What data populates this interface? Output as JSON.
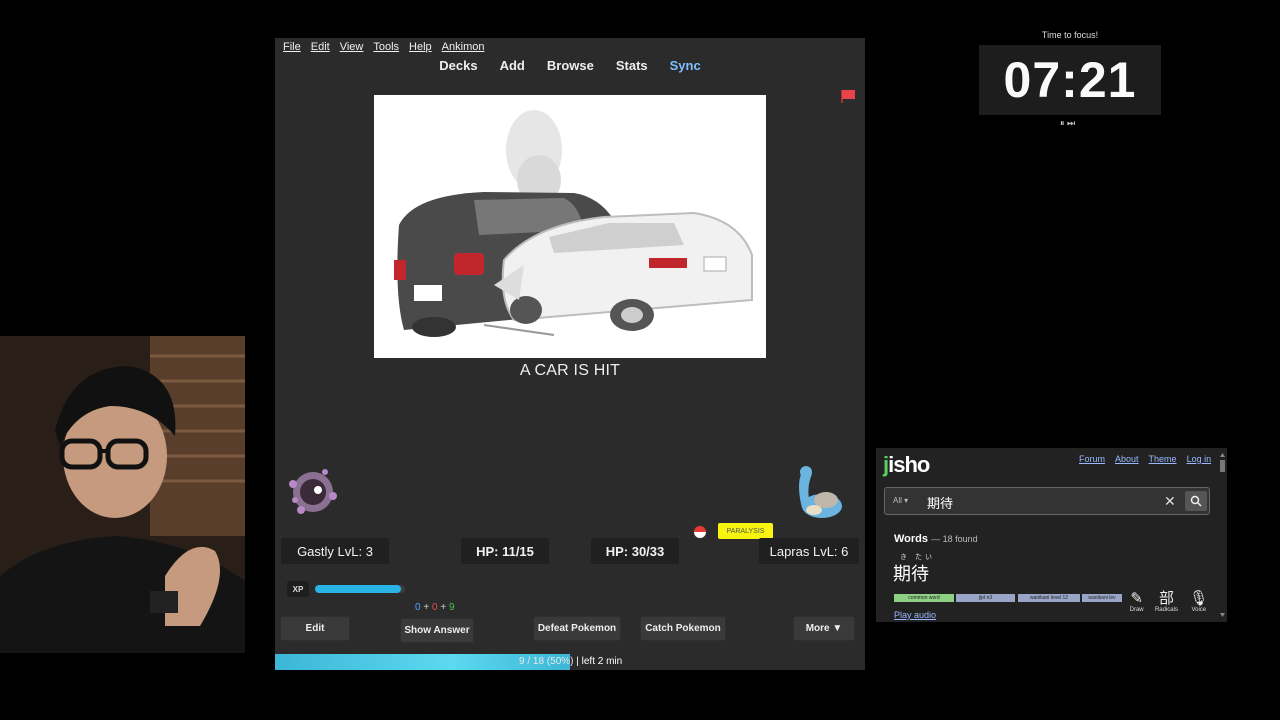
{
  "anki": {
    "menu": [
      "File",
      "Edit",
      "View",
      "Tools",
      "Help",
      "Ankimon"
    ],
    "tabs": [
      "Decks",
      "Add",
      "Browse",
      "Stats",
      "Sync"
    ],
    "card_text": "A CAR IS HIT",
    "battle": {
      "player": "Gastly LvL: 3",
      "player_hp": "HP: 11/15",
      "enemy_hp": "HP: 30/33",
      "enemy": "Lapras LvL: 6",
      "status": "PARALYSIS",
      "xp_label": "XP",
      "xp_progress": 0.95
    },
    "counts": {
      "new": "0",
      "plus1": "+",
      "learn": "0",
      "plus2": "+",
      "review": "9"
    },
    "buttons": {
      "edit": "Edit",
      "show_answer": "Show Answer",
      "defeat": "Defeat Pokemon",
      "catch": "Catch Pokemon",
      "more": "More ▼"
    },
    "progress": {
      "text": "9 / 18 (50%)",
      "left": "| left 2 min",
      "fraction": 0.5
    },
    "accent_color": "#7fbfff",
    "flag_color": "#e8434a"
  },
  "timer": {
    "title": "Time to focus!",
    "time": "07:21",
    "controls": "⏸ ⏭"
  },
  "jisho": {
    "logo_j": "j",
    "logo_rest": "isho",
    "nav": [
      "Forum",
      "About",
      "Theme",
      "Log in"
    ],
    "filter": "All ▾",
    "query": "期待",
    "clear": "✕",
    "words_label": "Words",
    "found": "— 18 found",
    "furigana": "き たい",
    "word": "期待",
    "tags": [
      "common word",
      "jlpt n3",
      "wanikani level 12",
      "wanikani lev"
    ],
    "play_audio": "Play audio",
    "tools": [
      {
        "glyph": "✎",
        "label": "Draw"
      },
      {
        "glyph": "部",
        "label": "Radicals"
      },
      {
        "glyph": "🎙",
        "label": "Voice"
      }
    ]
  }
}
